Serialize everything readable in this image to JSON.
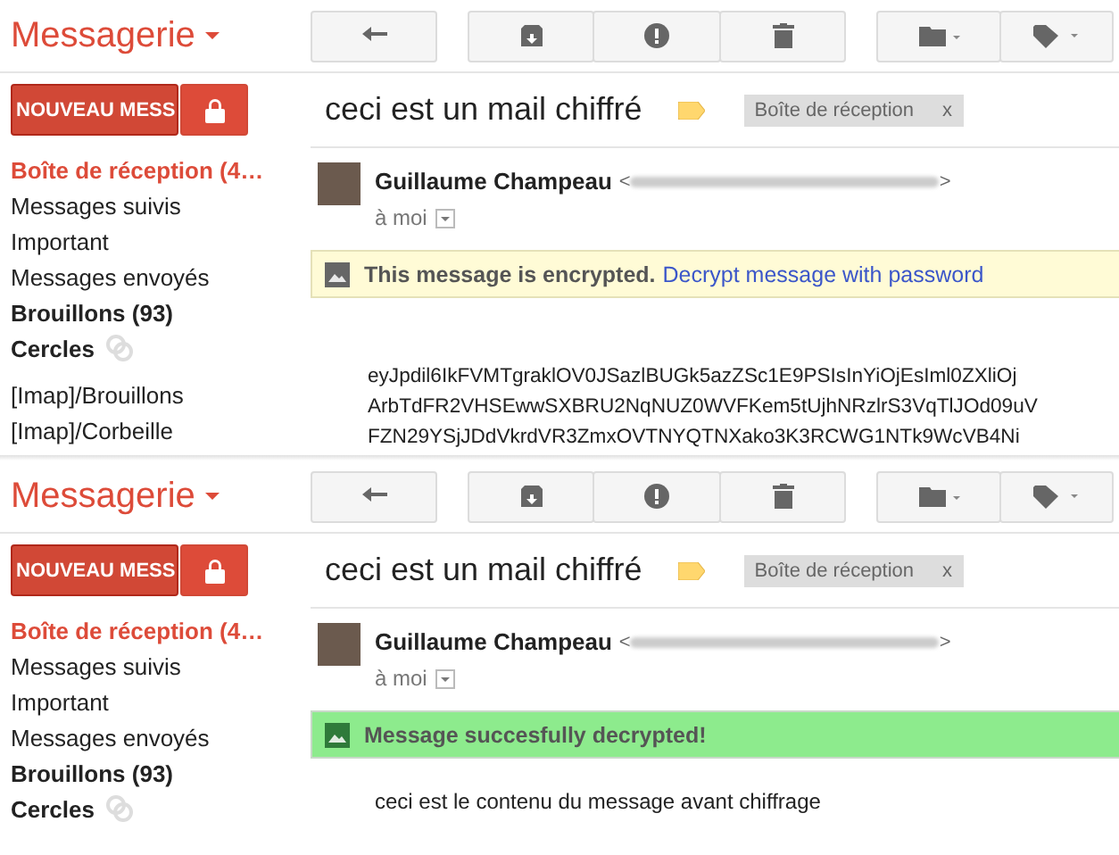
{
  "panels": [
    {
      "logo": "Messagerie",
      "compose_button": "NOUVEAU MESS",
      "folders": [
        {
          "label": "Boîte de réception (4…",
          "selected": true,
          "bold": false,
          "kind": "folder"
        },
        {
          "label": "Messages suivis",
          "selected": false,
          "bold": false,
          "kind": "folder"
        },
        {
          "label": "Important",
          "selected": false,
          "bold": false,
          "kind": "folder"
        },
        {
          "label": "Messages envoyés",
          "selected": false,
          "bold": false,
          "kind": "folder"
        },
        {
          "label": "Brouillons (93)",
          "selected": false,
          "bold": true,
          "kind": "folder"
        },
        {
          "label": "Cercles",
          "selected": false,
          "bold": true,
          "kind": "circles"
        }
      ],
      "imap_folders": [
        {
          "label": "[Imap]/Brouillons",
          "selected": false
        },
        {
          "label": "[Imap]/Corbeille",
          "selected": false
        }
      ],
      "subject": "ceci est un mail chiffré",
      "label_chip": {
        "text": "Boîte de réception",
        "close": "x"
      },
      "sender_name": "Guillaume Champeau",
      "email_brackets": [
        "<",
        ">"
      ],
      "to_line": "à moi",
      "banner": {
        "kind": "encrypted",
        "text": "This message is encrypted.",
        "link": "Decrypt message with password"
      },
      "body_lines": [
        "eyJpdil6IkFVMTgraklOV0JSazlBUGk5azZSc1E9PSIsInYiOjEsIml0ZXliOj",
        "ArbTdFR2VHSEwwSXBRU2NqNUZ0WVFKem5tUjhNRzlrS3VqTlJOd09uV",
        "FZN29YSjJDdVkrdVR3ZmxOVTNYQTNXako3K3RCWG1NTk9WcVB4Ni"
      ]
    },
    {
      "logo": "Messagerie",
      "compose_button": "NOUVEAU MESS",
      "folders": [
        {
          "label": "Boîte de réception (4…",
          "selected": true,
          "bold": false,
          "kind": "folder"
        },
        {
          "label": "Messages suivis",
          "selected": false,
          "bold": false,
          "kind": "folder"
        },
        {
          "label": "Important",
          "selected": false,
          "bold": false,
          "kind": "folder"
        },
        {
          "label": "Messages envoyés",
          "selected": false,
          "bold": false,
          "kind": "folder"
        },
        {
          "label": "Brouillons (93)",
          "selected": false,
          "bold": true,
          "kind": "folder"
        },
        {
          "label": "Cercles",
          "selected": false,
          "bold": true,
          "kind": "circles"
        }
      ],
      "subject": "ceci est un mail chiffré",
      "label_chip": {
        "text": "Boîte de réception",
        "close": "x"
      },
      "sender_name": "Guillaume Champeau",
      "email_brackets": [
        "<",
        ">"
      ],
      "to_line": "à moi",
      "banner": {
        "kind": "decrypted",
        "text": "Message succesfully decrypted!"
      },
      "body_lines": [
        "ceci est le contenu du message avant chiffrage"
      ]
    }
  ]
}
